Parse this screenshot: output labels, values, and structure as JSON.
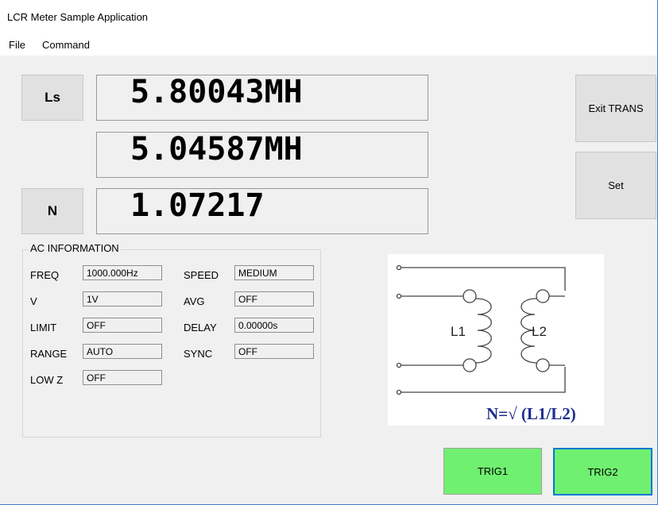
{
  "window": {
    "title": "LCR Meter Sample Application"
  },
  "menu": {
    "file": "File",
    "command": "Command"
  },
  "display": {
    "param1_label": "Ls",
    "param2_label": "N",
    "primary": "5.80043MH",
    "secondary": "5.04587MH",
    "tertiary": "1.07217"
  },
  "side_buttons": {
    "exit": "Exit TRANS",
    "set": "Set"
  },
  "ac_info": {
    "title": "AC INFORMATION",
    "freq": {
      "label": "FREQ",
      "value": "1000.000Hz"
    },
    "v": {
      "label": "V",
      "value": "1V"
    },
    "limit": {
      "label": "LIMIT",
      "value": "OFF"
    },
    "range": {
      "label": "RANGE",
      "value": "AUTO"
    },
    "lowz": {
      "label": "LOW Z",
      "value": "OFF"
    },
    "speed": {
      "label": "SPEED",
      "value": "MEDIUM"
    },
    "avg": {
      "label": "AVG",
      "value": "OFF"
    },
    "delay": {
      "label": "DELAY",
      "value": "0.00000s"
    },
    "sync": {
      "label": "SYNC",
      "value": "OFF"
    }
  },
  "diagram": {
    "l1": "L1",
    "l2": "L2",
    "formula": "N=√ (L1/L2)"
  },
  "trigger": {
    "trig1": "TRIG1",
    "trig2": "TRIG2"
  },
  "colors": {
    "trigger_green": "#70f070",
    "focus_blue": "#0078d7",
    "formula_blue": "#1f2e8f"
  }
}
